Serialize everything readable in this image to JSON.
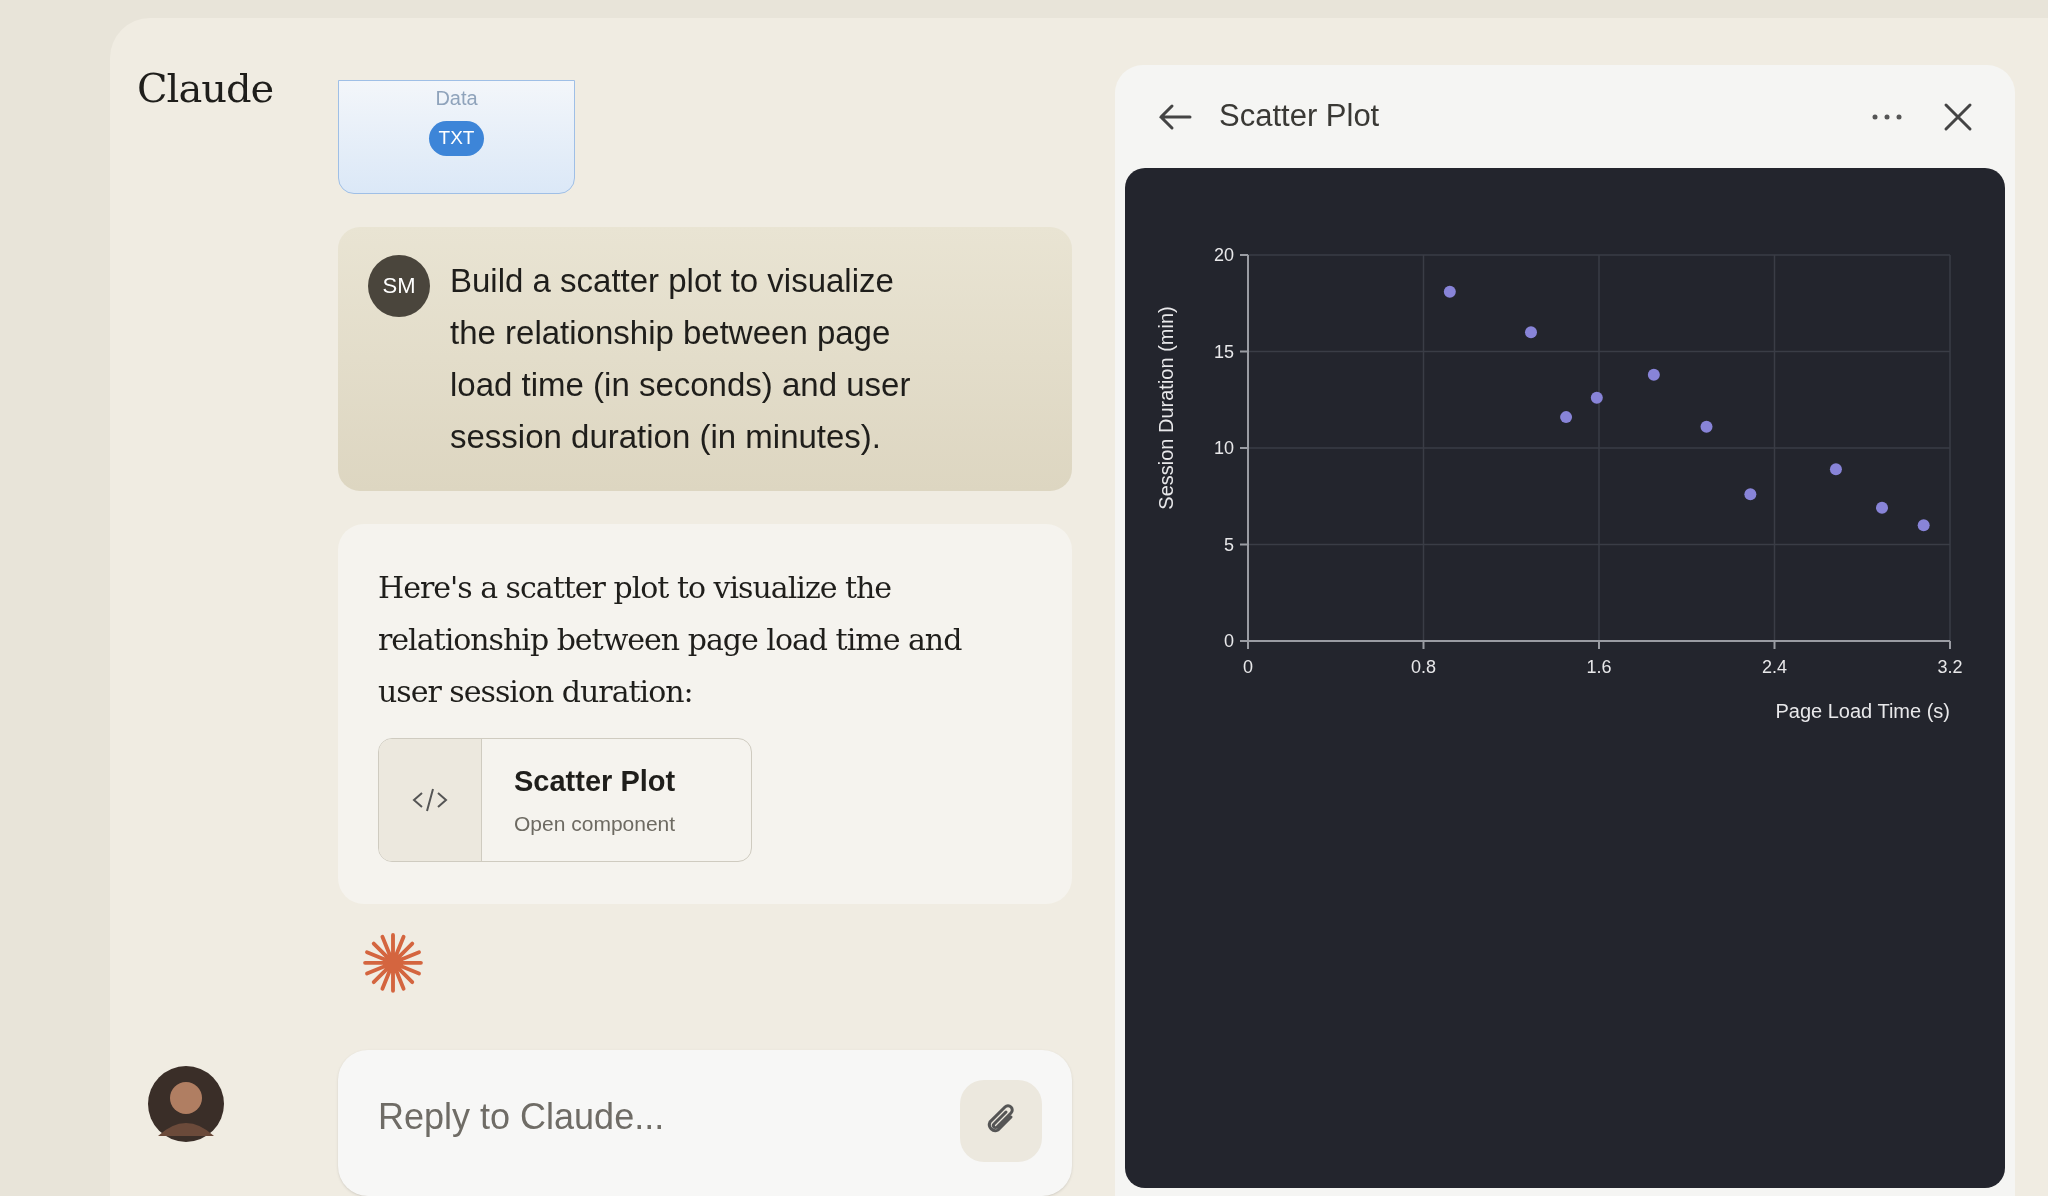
{
  "sidebar": {
    "logo": "Claude"
  },
  "file_card": {
    "name": "Data",
    "type": "TXT"
  },
  "user_message": {
    "initials": "SM",
    "text": "Build a scatter plot to visualize the relationship between page load time (in seconds) and user session duration (in minutes)."
  },
  "assistant_message": {
    "text": "Here's a scatter plot to visualize the relationship between page load time and user session duration:",
    "artifact": {
      "title": "Scatter Plot",
      "subtitle": "Open component"
    }
  },
  "composer": {
    "placeholder": "Reply to Claude..."
  },
  "panel": {
    "title": "Scatter Plot",
    "chart_data": {
      "type": "scatter",
      "xlabel": "Page Load Time (s)",
      "ylabel": "Session Duration (min)",
      "x": [
        0.92,
        1.29,
        1.45,
        1.59,
        1.85,
        2.09,
        2.29,
        2.68,
        2.89,
        3.08
      ],
      "series": [
        {
          "color": "#8884d8",
          "values": [
            18.1,
            16.0,
            11.6,
            12.6,
            13.8,
            11.1,
            7.6,
            8.9,
            6.9,
            6.0
          ]
        }
      ],
      "xlim": [
        0,
        3.2
      ],
      "ylim": [
        0,
        20
      ],
      "xticks": [
        0,
        0.8,
        1.6,
        2.4,
        3.2
      ],
      "yticks": [
        0,
        5,
        10,
        15,
        20
      ],
      "grid": true
    }
  }
}
